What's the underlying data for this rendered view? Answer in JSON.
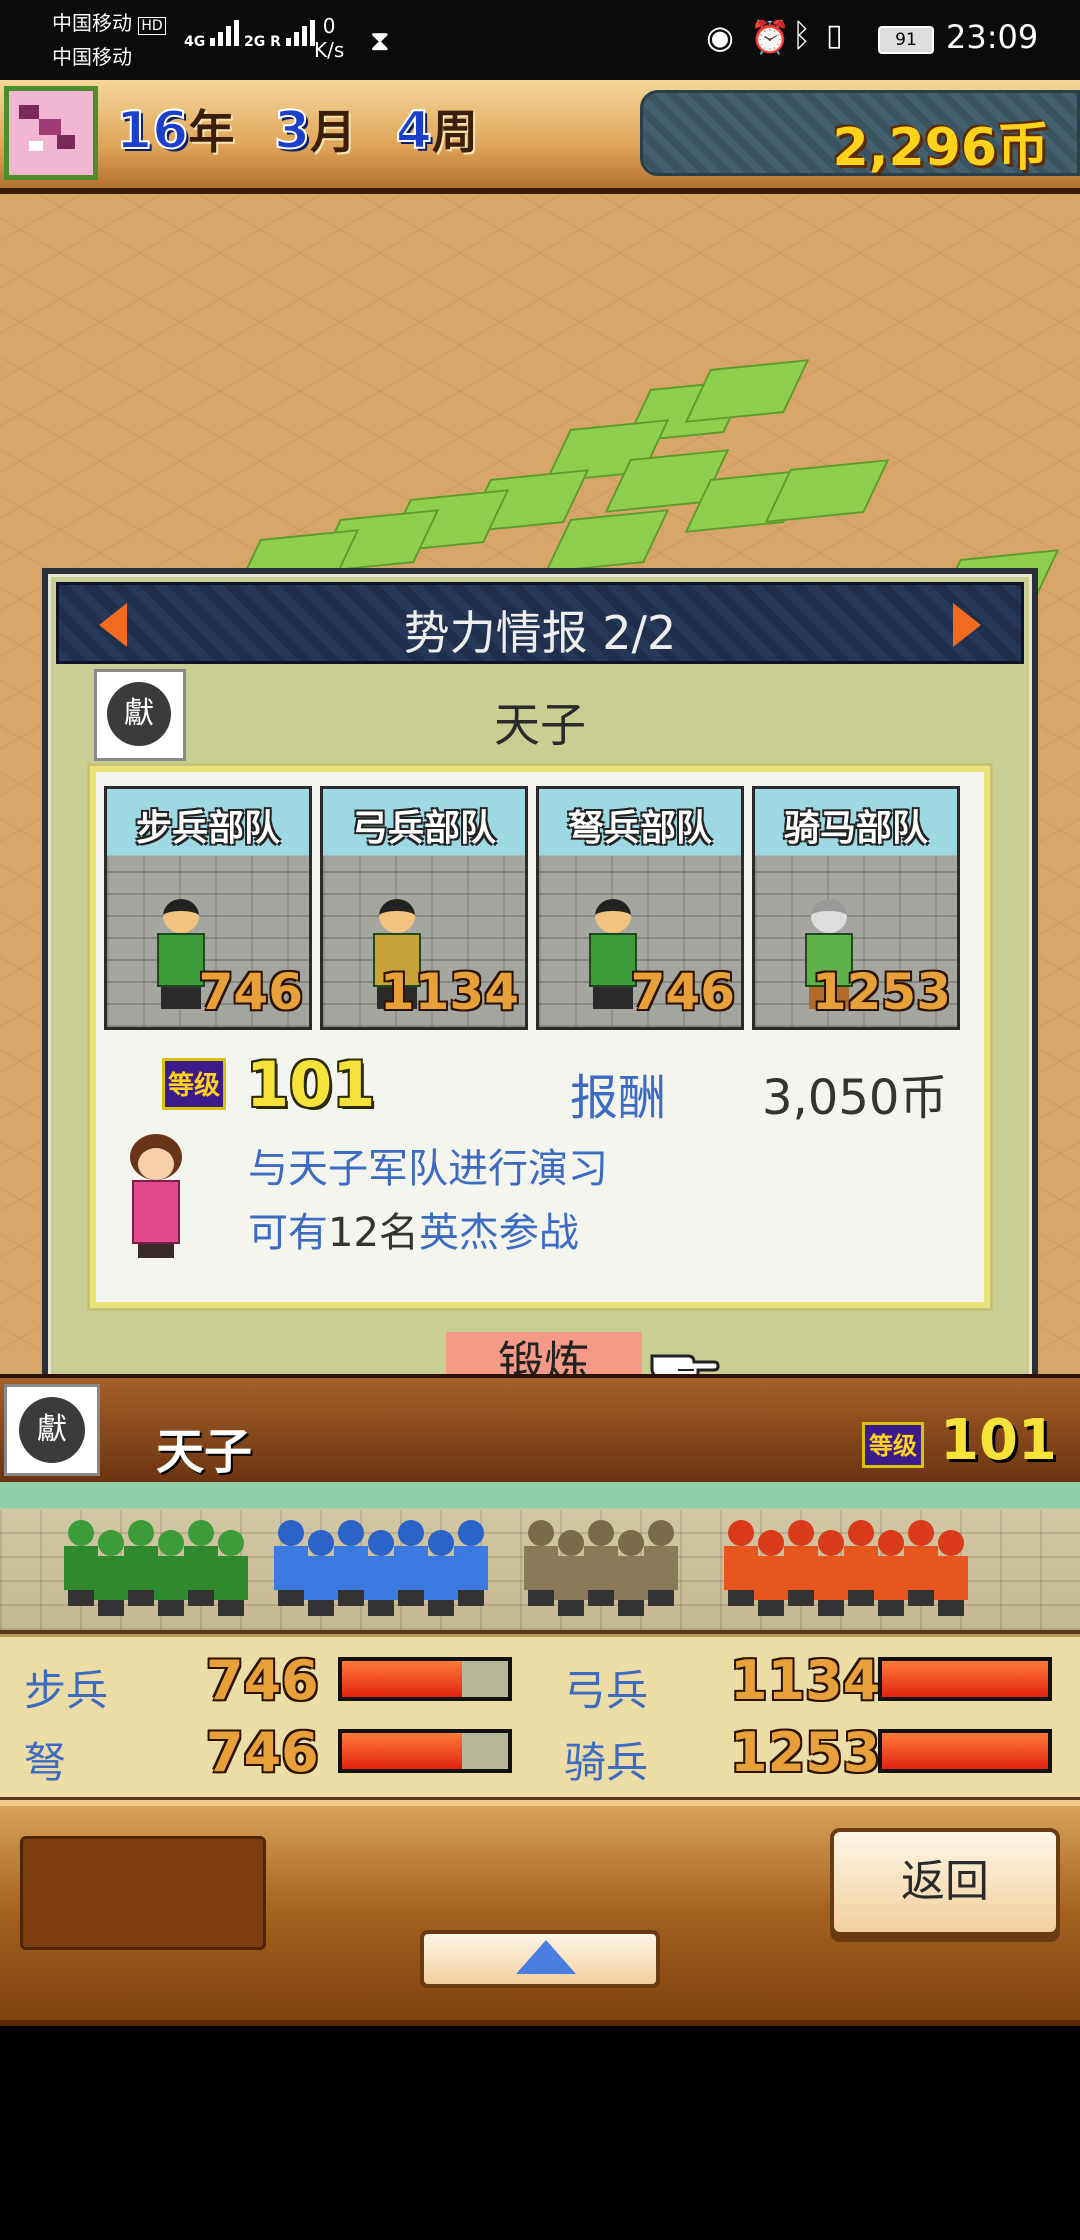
{
  "status_bar": {
    "carrier_1": "中国移动",
    "hd_badge": "HD",
    "carrier_2": "中国移动",
    "net_1": "4G",
    "net_2": "2G R",
    "speed_value": "0",
    "speed_unit": "K/s",
    "battery": "91",
    "time": "23:09"
  },
  "topbar": {
    "year_value": "16",
    "year_label": "年",
    "month_value": "3",
    "month_label": "月",
    "week_value": "4",
    "week_label": "周",
    "coins": "2,296币"
  },
  "dialog": {
    "title": "势力情报 2/2",
    "emblem_char": "獻",
    "faction_name": "天子",
    "units": [
      {
        "label": "步兵部队",
        "count": "746"
      },
      {
        "label": "弓兵部队",
        "count": "1134"
      },
      {
        "label": "弩兵部队",
        "count": "746"
      },
      {
        "label": "骑马部队",
        "count": "1253"
      }
    ],
    "rank_badge": "等级",
    "rank_value": "101",
    "reward_label": "报酬",
    "reward_value": "3,050币",
    "desc_line1": "与天子军队进行演习",
    "desc_line2_a": "可有",
    "desc_line2_b": "12名",
    "desc_line2_c": "英杰参战",
    "train_button": "锻炼"
  },
  "faction_strip": {
    "emblem_char": "獻",
    "name": "天子",
    "rank_badge": "等级",
    "rank_value": "101"
  },
  "stats": {
    "infantry_label": "步兵",
    "infantry_value": "746",
    "infantry_fill": 0.72,
    "archer_label": "弓兵",
    "archer_value": "1134",
    "archer_fill": 1.0,
    "crossbow_label": "弩",
    "crossbow_value": "746",
    "crossbow_fill": 0.72,
    "cavalry_label": "骑兵",
    "cavalry_value": "1253",
    "cavalry_fill": 1.0
  },
  "footer": {
    "back_button": "返回"
  },
  "colors": {
    "dialog_bg": "#c9cf93",
    "accent_blue": "#3d6bc2",
    "coin_yellow": "#ffd21c",
    "bar_red": "#e2240f"
  }
}
